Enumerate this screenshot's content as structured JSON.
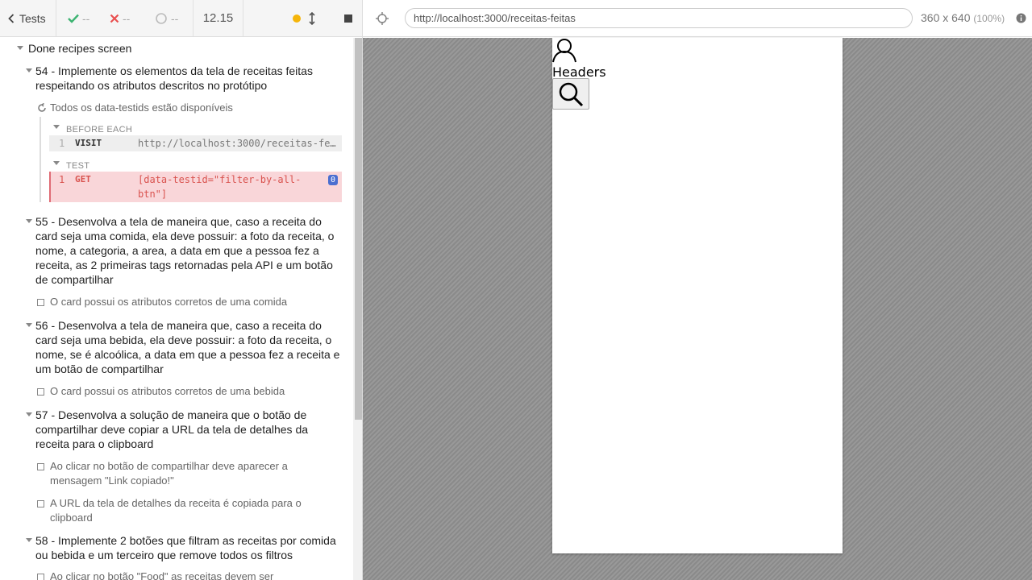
{
  "stats": {
    "tests_label": "Tests",
    "passed": "--",
    "failed": "--",
    "pending": "--",
    "duration": "12.15"
  },
  "url": {
    "value": "http://localhost:3000/receitas-feitas"
  },
  "viewport": {
    "size": "360 x 640",
    "zoom": "(100%)"
  },
  "runnables": {
    "root_suite": "Done recipes screen",
    "suites": [
      {
        "title": "54 - Implemente os elementos da tela de receitas feitas respeitando os atributos descritos no protótipo",
        "tests": [
          "Todos os data-testids estão disponíveis"
        ]
      },
      {
        "title": "55 - Desenvolva a tela de maneira que, caso a receita do card seja uma comida, ela deve possuir: a foto da receita, o nome, a categoria, a area, a data em que a pessoa fez a receita, as 2 primeiras tags retornadas pela API e um botão de compartilhar",
        "tests": [
          "O card possui os atributos corretos de uma comida"
        ]
      },
      {
        "title": "56 - Desenvolva a tela de maneira que, caso a receita do card seja uma bebida, ela deve possuir: a foto da receita, o nome, se é alcoólica, a data em que a pessoa fez a receita e um botão de compartilhar",
        "tests": [
          "O card possui os atributos corretos de uma bebida"
        ]
      },
      {
        "title": "57 - Desenvolva a solução de maneira que o botão de compartilhar deve copiar a URL da tela de detalhes da receita para o clipboard",
        "tests": [
          "Ao clicar no botão de compartilhar deve aparecer a mensagem \"Link copiado!\"",
          "A URL da tela de detalhes da receita é copiada para o clipboard"
        ]
      },
      {
        "title": "58 - Implemente 2 botões que filtram as receitas por comida ou bebida e um terceiro que remove todos os filtros",
        "tests": [
          "Ao clicar no botão \"Food\" as receitas devem ser"
        ]
      }
    ],
    "commands": {
      "before_each_label": "BEFORE EACH",
      "test_label": "TEST",
      "visit": {
        "num": "1",
        "name": "VISIT",
        "message": "http://localhost:3000/receitas-fe…"
      },
      "get": {
        "num": "1",
        "name": "GET",
        "message_line1": "[data-testid=\"filter-by-all-",
        "message_line2": "btn\"]",
        "badge": "0"
      }
    }
  },
  "app": {
    "header_text": "Headers"
  },
  "colors": {
    "pass": "#3cb371",
    "fail": "#e94f4f",
    "running_dot": "#f5b50a",
    "error_bg": "#f9d6d9",
    "error_border": "#e06c75",
    "badge": "#4b6fd0"
  }
}
